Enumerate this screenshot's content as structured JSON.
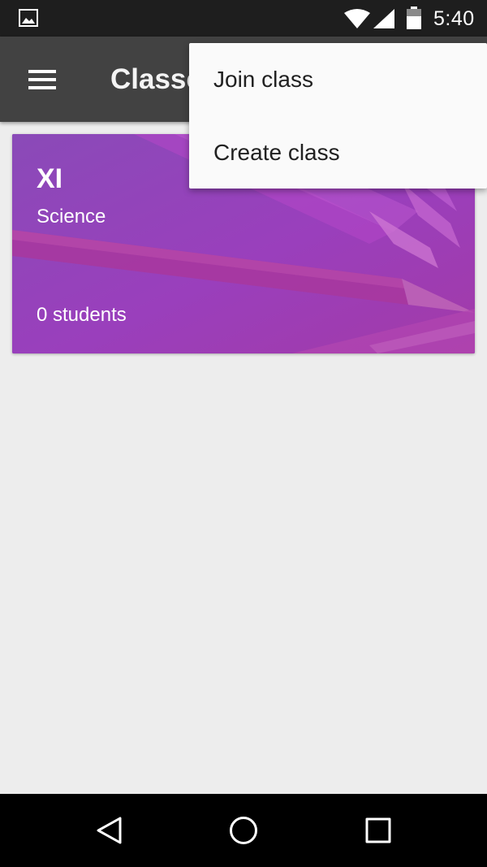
{
  "status_bar": {
    "time": "5:40",
    "icons": [
      "gallery-icon",
      "wifi-icon",
      "signal-icon",
      "battery-icon"
    ]
  },
  "app_bar": {
    "title": "Classes",
    "menu_icon": "hamburger-menu-icon",
    "background": "#424242"
  },
  "class_card": {
    "name": "XI",
    "section": "Science",
    "students": "0 students",
    "accent": "#8c44b4"
  },
  "popup_menu": {
    "items": [
      {
        "label": "Join class"
      },
      {
        "label": "Create class"
      }
    ]
  },
  "nav_bar": {
    "icons": [
      "back-icon",
      "home-icon",
      "recents-icon"
    ]
  }
}
